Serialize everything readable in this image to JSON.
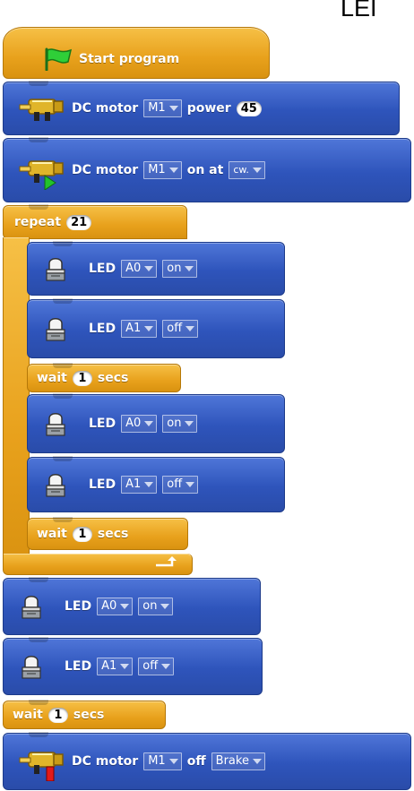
{
  "corner_text": "LEI",
  "start": {
    "label": "Start program"
  },
  "dc_power": {
    "label": "DC motor",
    "motor": "M1",
    "kw": "power",
    "value": "45"
  },
  "dc_on": {
    "label": "DC motor",
    "motor": "M1",
    "kw": "on at",
    "dir": "cw."
  },
  "repeat": {
    "label": "repeat",
    "count": "21"
  },
  "led": {
    "label": "LED",
    "a0": "A0",
    "a1": "A1",
    "on": "on",
    "off": "off"
  },
  "wait": {
    "label": "wait",
    "value": "1",
    "unit": "secs"
  },
  "dc_off": {
    "label": "DC motor",
    "motor": "M1",
    "kw": "off",
    "mode": "Brake"
  },
  "colors": {
    "motion_blue": "#2e54bb",
    "control_orange": "#e8a11c",
    "flag_green": "#1fae2c"
  },
  "icons": [
    "flag-icon",
    "motor-icon",
    "led-icon",
    "loop-arrow-icon",
    "dropdown-arrow-icon"
  ]
}
